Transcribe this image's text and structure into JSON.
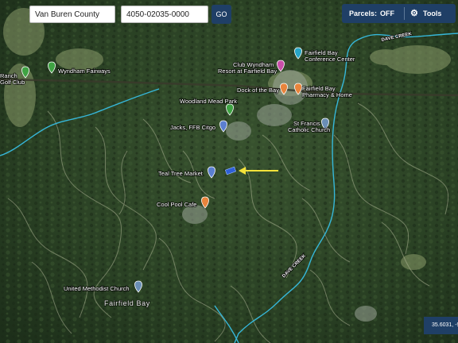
{
  "search": {
    "county_value": "Van Buren County",
    "parcel_value": "4050-02035-0000",
    "go_label": "GO"
  },
  "toolbar": {
    "parcels_label": "Parcels:",
    "parcels_value": "OFF",
    "tools_label": "Tools",
    "gear_icon": "gear-icon"
  },
  "coords": {
    "text": "35.6031, -9"
  },
  "map_labels": {
    "ranch_golf": [
      "Ranch",
      "Golf Club"
    ],
    "wyndham_fairways": "Wyndham Fairways",
    "club_wyndham": [
      "Club Wyndham",
      "Resort at Fairfield Bay"
    ],
    "conference_center": [
      "Fairfield Bay",
      "Conference Center"
    ],
    "dock_of_the_bay": "Dock of the Bay",
    "pharmacy": [
      "Fairfield Bay",
      "Pharmacy & Home"
    ],
    "woodland_mead_park": "Woodland Mead Park",
    "jacks_citgo": "Jacks, FFB Citgo",
    "st_francis": [
      "St Francis",
      "Catholic Church"
    ],
    "teal_tree_market": "Teal Tree Market",
    "cool_pool_cafe": "Cool Pool Cafe",
    "united_methodist": "United Methodist Church",
    "fairfield_bay": "Fairfield Bay",
    "dave_creek_1": "DAVE CREEK",
    "dave_creek_2": "DAVE CREEK"
  },
  "colors": {
    "toolbar_bg": "#1f3f66",
    "pin_green": "#3fa343",
    "pin_pink": "#c84fa8",
    "pin_orange": "#e8843c",
    "pin_blue": "#5b7fd0",
    "pin_teal": "#27a4c5",
    "pin_steel": "#6a8eb5",
    "arrow": "#f4e23a",
    "creek": "#36b7d9",
    "parcel_marker": "#2f60d8"
  }
}
